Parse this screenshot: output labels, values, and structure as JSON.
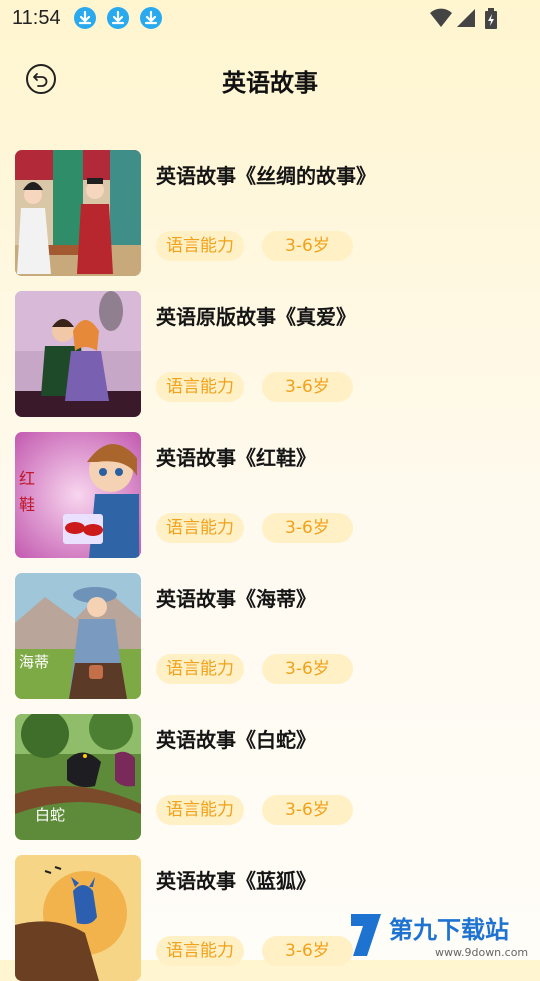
{
  "status_bar": {
    "time": "11:54",
    "notification_icons": [
      "download-icon",
      "download-icon",
      "download-icon"
    ],
    "system_icons": [
      "wifi-icon",
      "signal-icon",
      "battery-icon"
    ]
  },
  "header": {
    "back_icon": "back-arrow-icon",
    "title": "英语故事"
  },
  "stories": [
    {
      "title": "英语故事《丝绸的故事》",
      "tag_skill": "语言能力",
      "tag_age": "3-6岁"
    },
    {
      "title": "英语原版故事《真爱》",
      "tag_skill": "语言能力",
      "tag_age": "3-6岁"
    },
    {
      "title": "英语故事《红鞋》",
      "tag_skill": "语言能力",
      "tag_age": "3-6岁",
      "cover_text": "红鞋"
    },
    {
      "title": "英语故事《海蒂》",
      "tag_skill": "语言能力",
      "tag_age": "3-6岁",
      "cover_text": "海蒂"
    },
    {
      "title": "英语故事《白蛇》",
      "tag_skill": "语言能力",
      "tag_age": "3-6岁",
      "cover_text": "白蛇"
    },
    {
      "title": "英语故事《蓝狐》",
      "tag_skill": "语言能力",
      "tag_age": "3-6岁"
    }
  ],
  "watermark": {
    "text": "第九下载站",
    "url": "www.9down.com"
  },
  "colors": {
    "accent": "#f0a21a",
    "tag_bg": "#fff0c6",
    "download_badge": "#29a9ee"
  }
}
